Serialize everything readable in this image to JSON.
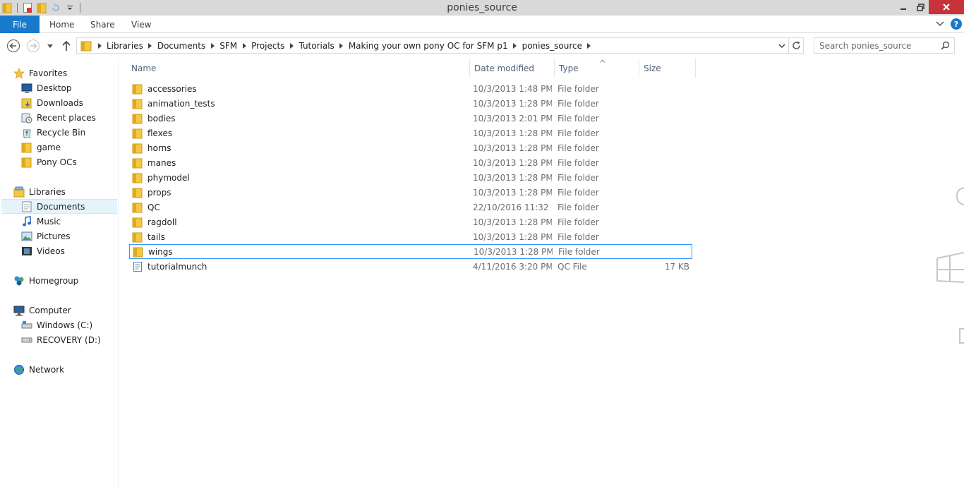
{
  "window": {
    "title": "ponies_source"
  },
  "ribbon": {
    "file_label": "File",
    "tabs": [
      "Home",
      "Share",
      "View"
    ]
  },
  "address": {
    "breadcrumbs": [
      "Libraries",
      "Documents",
      "SFM",
      "Projects",
      "Tutorials",
      "Making your own pony OC for SFM p1",
      "ponies_source"
    ]
  },
  "search": {
    "placeholder": "Search ponies_source"
  },
  "navpane": {
    "favorites_label": "Favorites",
    "favorites": [
      "Desktop",
      "Downloads",
      "Recent places",
      "Recycle Bin",
      "game",
      "Pony OCs"
    ],
    "libraries_label": "Libraries",
    "libraries": [
      "Documents",
      "Music",
      "Pictures",
      "Videos"
    ],
    "homegroup_label": "Homegroup",
    "computer_label": "Computer",
    "drives": [
      "Windows (C:)",
      "RECOVERY (D:)"
    ],
    "network_label": "Network"
  },
  "columns": {
    "name": "Name",
    "date": "Date modified",
    "type": "Type",
    "size": "Size"
  },
  "files": [
    {
      "name": "accessories",
      "date": "10/3/2013 1:48 PM",
      "type": "File folder",
      "size": ""
    },
    {
      "name": "animation_tests",
      "date": "10/3/2013 1:28 PM",
      "type": "File folder",
      "size": ""
    },
    {
      "name": "bodies",
      "date": "10/3/2013 2:01 PM",
      "type": "File folder",
      "size": ""
    },
    {
      "name": "flexes",
      "date": "10/3/2013 1:28 PM",
      "type": "File folder",
      "size": ""
    },
    {
      "name": "horns",
      "date": "10/3/2013 1:28 PM",
      "type": "File folder",
      "size": ""
    },
    {
      "name": "manes",
      "date": "10/3/2013 1:28 PM",
      "type": "File folder",
      "size": ""
    },
    {
      "name": "phymodel",
      "date": "10/3/2013 1:28 PM",
      "type": "File folder",
      "size": ""
    },
    {
      "name": "props",
      "date": "10/3/2013 1:28 PM",
      "type": "File folder",
      "size": ""
    },
    {
      "name": "QC",
      "date": "22/10/2016 11:32 ...",
      "type": "File folder",
      "size": ""
    },
    {
      "name": "ragdoll",
      "date": "10/3/2013 1:28 PM",
      "type": "File folder",
      "size": ""
    },
    {
      "name": "tails",
      "date": "10/3/2013 1:28 PM",
      "type": "File folder",
      "size": ""
    },
    {
      "name": "wings",
      "date": "10/3/2013 1:28 PM",
      "type": "File folder",
      "size": ""
    },
    {
      "name": "tutorialmunch",
      "date": "4/11/2016 3:20 PM",
      "type": "QC File",
      "size": "17 KB"
    }
  ],
  "selected_file": "wings",
  "selected_nav": "Documents",
  "colors": {
    "file_tab": "#1979ca",
    "close_button": "#c7333a",
    "selection_border": "#3399ff",
    "nav_selected": "#e5f3fb",
    "folder": "#f5c842"
  }
}
